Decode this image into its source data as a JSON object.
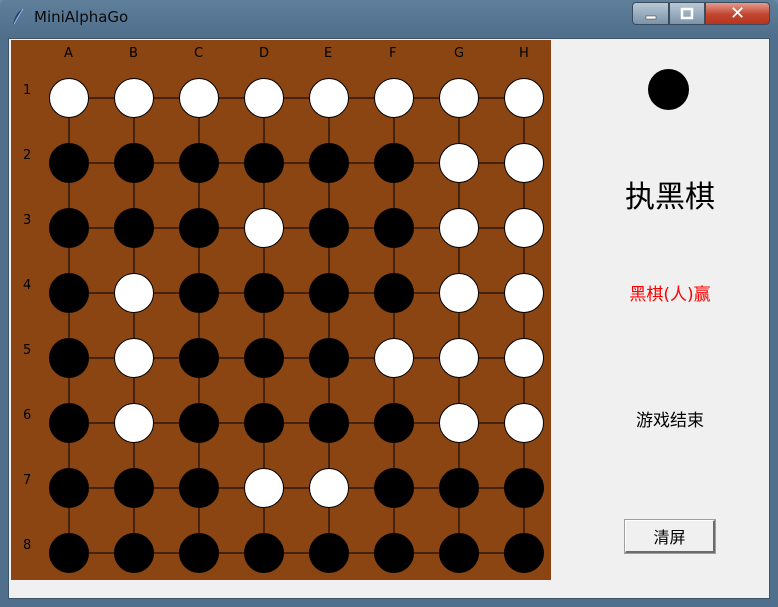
{
  "window": {
    "title": "MiniAlphaGo",
    "close_glyph": "✕",
    "colors": {
      "board": "#8b4513",
      "black_stone": "#000000",
      "white_stone": "#ffffff",
      "result": "#ff0000"
    }
  },
  "board": {
    "columns": [
      "A",
      "B",
      "C",
      "D",
      "E",
      "F",
      "G",
      "H"
    ],
    "rows": [
      "1",
      "2",
      "3",
      "4",
      "5",
      "6",
      "7",
      "8"
    ],
    "stones": [
      [
        "W",
        "W",
        "W",
        "W",
        "W",
        "W",
        "W",
        "W"
      ],
      [
        "B",
        "B",
        "B",
        "B",
        "B",
        "B",
        "W",
        "W"
      ],
      [
        "B",
        "B",
        "B",
        "W",
        "B",
        "B",
        "W",
        "W"
      ],
      [
        "B",
        "W",
        "B",
        "B",
        "B",
        "B",
        "W",
        "W"
      ],
      [
        "B",
        "W",
        "B",
        "B",
        "B",
        "W",
        "W",
        "W"
      ],
      [
        "B",
        "W",
        "B",
        "B",
        "B",
        "B",
        "W",
        "W"
      ],
      [
        "B",
        "B",
        "B",
        "W",
        "W",
        "B",
        "B",
        "B"
      ],
      [
        "B",
        "B",
        "B",
        "B",
        "B",
        "B",
        "B",
        "B"
      ]
    ]
  },
  "side": {
    "turn_stone_color": "black",
    "player_text": "执黑棋",
    "result_text": "黑棋(人)赢",
    "status_text": "游戏结束",
    "clear_button_label": "清屏"
  }
}
